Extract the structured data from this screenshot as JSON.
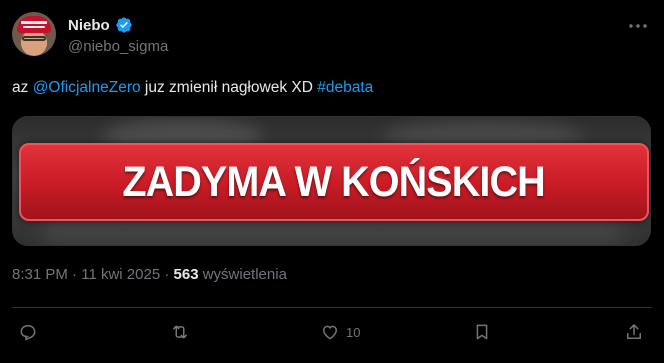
{
  "tweet": {
    "author": {
      "display_name": "Niebo",
      "handle": "@niebo_sigma",
      "verified": true
    },
    "text_prefix": "az ",
    "mention": "@OficjalneZero",
    "text_middle": " juz zmienił nagłowek XD ",
    "hashtag": "#debata",
    "media": {
      "banner_text": "ZADYMA W KOŃSKICH"
    },
    "meta": {
      "time": "8:31 PM",
      "separator1": " · ",
      "date": "11 kwi 2025",
      "separator2": " · ",
      "views_count": "563",
      "views_label": " wyświetlenia"
    },
    "actions": {
      "like_count": "10"
    }
  },
  "colors": {
    "background": "#000000",
    "link": "#1d9bf0",
    "secondary_text": "#71767b",
    "banner_red": "#c81b25"
  },
  "icons": [
    "verified-badge-icon",
    "more-icon",
    "reply-icon",
    "repost-icon",
    "like-icon",
    "bookmark-icon",
    "share-icon"
  ]
}
